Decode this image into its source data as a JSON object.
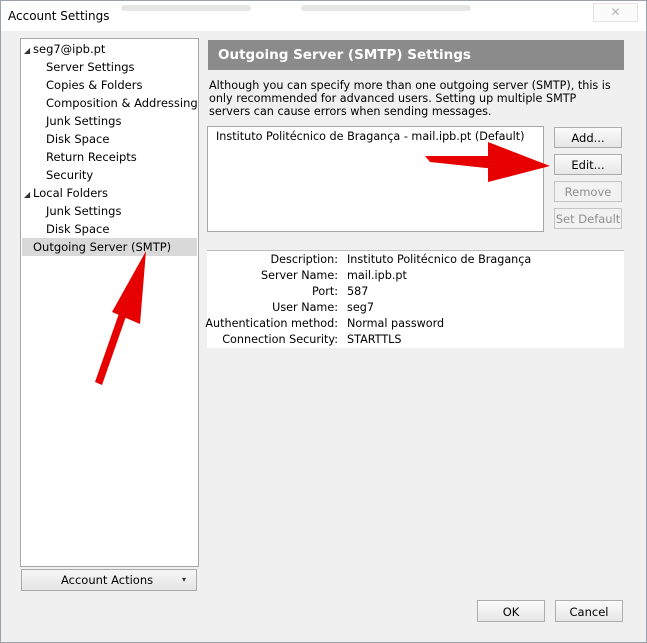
{
  "window": {
    "title": "Account Settings",
    "close_glyph": "✕"
  },
  "tree": {
    "account": {
      "label": "seg7@ipb.pt",
      "children": [
        "Server Settings",
        "Copies & Folders",
        "Composition & Addressing",
        "Junk Settings",
        "Disk Space",
        "Return Receipts",
        "Security"
      ]
    },
    "local": {
      "label": "Local Folders",
      "children": [
        "Junk Settings",
        "Disk Space"
      ]
    },
    "smtp_label": "Outgoing Server (SMTP)",
    "expand_glyph": "◢"
  },
  "account_actions": {
    "label": "Account Actions",
    "caret": "▾"
  },
  "panel": {
    "title": "Outgoing Server (SMTP) Settings",
    "description": "Although you can specify more than one outgoing server (SMTP), this is only recommended for advanced users. Setting up multiple SMTP servers can cause errors when sending messages.",
    "servers": [
      "Instituto Politécnico de Bragança - mail.ipb.pt (Default)"
    ],
    "buttons": {
      "add": "Add...",
      "edit": "Edit...",
      "remove": "Remove",
      "set_default": "Set Default"
    },
    "details": [
      {
        "key": "Description:",
        "value": "Instituto Politécnico de Bragança"
      },
      {
        "key": "Server Name:",
        "value": "mail.ipb.pt"
      },
      {
        "key": "Port:",
        "value": "587"
      },
      {
        "key": "User Name:",
        "value": "seg7"
      },
      {
        "key": "Authentication method:",
        "value": "Normal password"
      },
      {
        "key": "Connection Security:",
        "value": "STARTTLS"
      }
    ]
  },
  "footer": {
    "ok": "OK",
    "cancel": "Cancel"
  },
  "colors": {
    "header_bar": "#8b8b8b",
    "selection": "#d9d9d9",
    "arrow": "#e60000"
  }
}
